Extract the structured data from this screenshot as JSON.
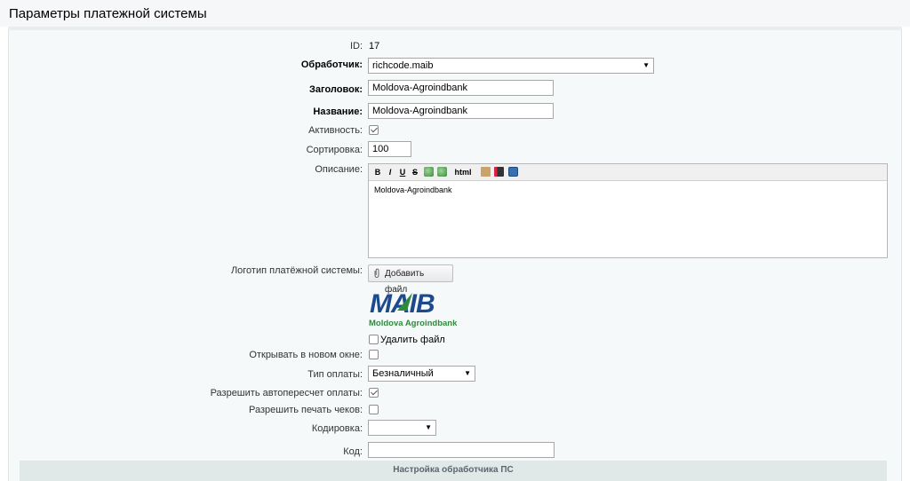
{
  "page": {
    "title": "Параметры платежной системы"
  },
  "form": {
    "id": {
      "label": "ID:",
      "value": "17"
    },
    "handler": {
      "label": "Обработчик:",
      "value": "richcode.maib"
    },
    "header": {
      "label": "Заголовок:",
      "value": "Moldova-Agroindbank"
    },
    "name": {
      "label": "Название:",
      "value": "Moldova-Agroindbank"
    },
    "active": {
      "label": "Активность:",
      "checked": true
    },
    "sort": {
      "label": "Сортировка:",
      "value": "100"
    },
    "description": {
      "label": "Описание:",
      "toolbar": [
        "B",
        "I",
        "U",
        "S",
        "html"
      ],
      "value": "Moldova-Agroindbank"
    },
    "logo": {
      "label": "Логотип платёжной системы:",
      "upload_label": "Добавить файл",
      "brand_text": "MAIB",
      "brand_sub": "Moldova Agroindbank",
      "delete_label": "Удалить файл"
    },
    "new_window": {
      "label": "Открывать в новом окне:",
      "checked": false
    },
    "pay_type": {
      "label": "Тип оплаты:",
      "value": "Безналичный"
    },
    "auto_recalc": {
      "label": "Разрешить автопересчет оплаты:",
      "checked": true
    },
    "print_checks": {
      "label": "Разрешить печать чеков:",
      "checked": false
    },
    "encoding": {
      "label": "Кодировка:",
      "value": ""
    },
    "code": {
      "label": "Код:",
      "value": ""
    }
  },
  "handler_section": {
    "title": "Настройка обработчика ПС"
  },
  "colors": {
    "brand_blue": "#1c4a8c",
    "brand_green": "#2f8a3c",
    "panel_bg": "#f5f9f9"
  }
}
